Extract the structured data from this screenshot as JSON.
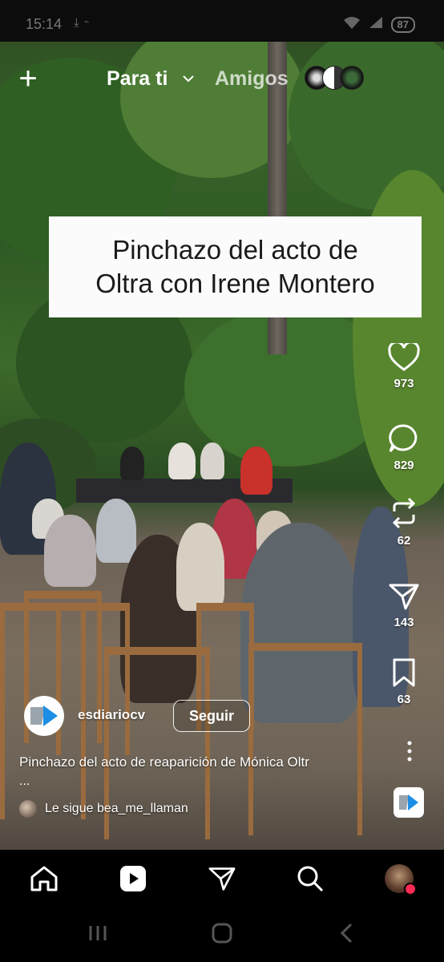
{
  "status_bar": {
    "time": "15:14",
    "icons": [
      "download-icon",
      "cast-icon"
    ],
    "battery": "87"
  },
  "top_nav": {
    "tabs": [
      {
        "label": "Para ti",
        "active": true
      },
      {
        "label": "Amigos",
        "active": false
      }
    ]
  },
  "video": {
    "overlay_caption": [
      "Pinchazo del acto de",
      "Oltra con Irene Montero"
    ]
  },
  "actions": {
    "likes": "973",
    "comments": "829",
    "reposts": "62",
    "shares": "143",
    "saves": "63"
  },
  "account": {
    "username": "esdiariocv",
    "follow_label": "Seguir"
  },
  "post": {
    "description": "Pinchazo del acto de reaparición de Mónica Oltr",
    "more": "...",
    "followed_by": "Le sigue bea_me_llaman"
  },
  "bottom_nav": [
    "home-icon",
    "reels-icon",
    "send-icon",
    "search-icon",
    "profile-avatar"
  ],
  "colors": {
    "background": "#000000",
    "notification_dot": "#ff2b55",
    "caption_box": "#fbfbfb"
  }
}
